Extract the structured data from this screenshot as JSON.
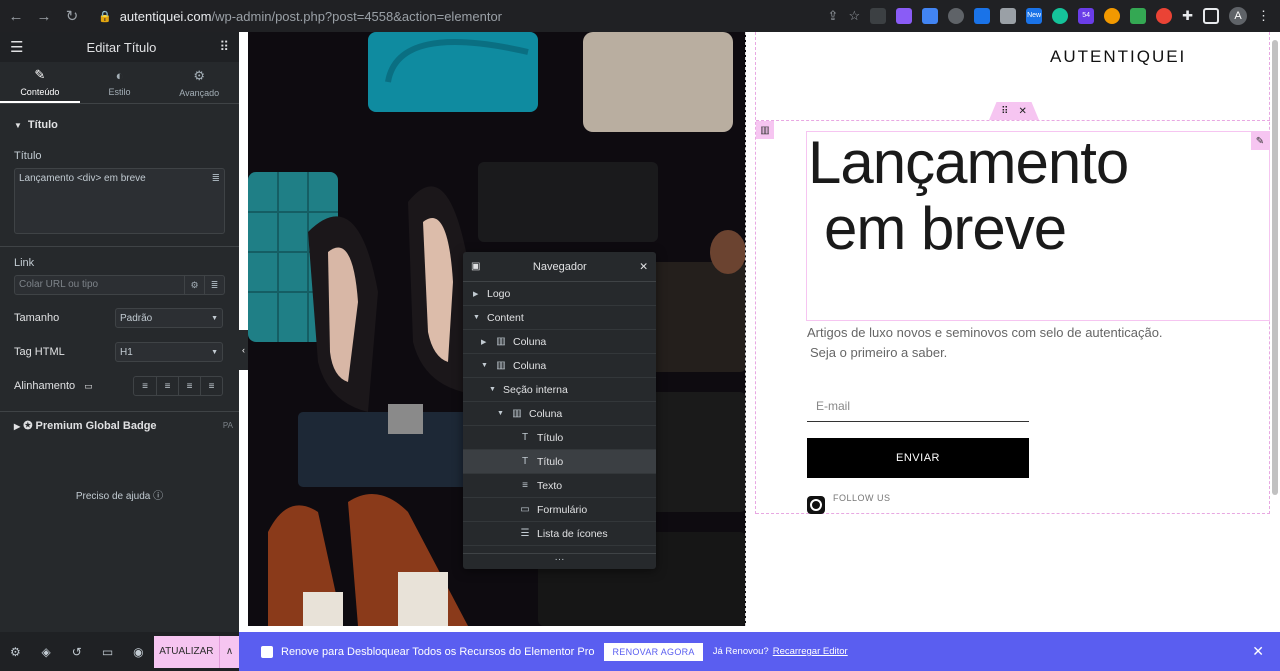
{
  "browser": {
    "host": "autentiquei.com",
    "path": "/wp-admin/post.php?post=4558&action=elementor",
    "avatar_letter": "A",
    "new_badge": "New",
    "badge_54": "54"
  },
  "panel": {
    "title": "Editar Título",
    "tabs": [
      {
        "label": "Conteúdo",
        "icon": "pencil-icon"
      },
      {
        "label": "Estilo",
        "icon": "contrast-icon"
      },
      {
        "label": "Avançado",
        "icon": "gear-icon"
      }
    ],
    "section_title": "Título",
    "title_label": "Título",
    "title_value": "Lançamento <div> em breve",
    "link_label": "Link",
    "link_placeholder": "Colar URL ou tipo",
    "size_label": "Tamanho",
    "size_value": "Padrão",
    "tag_label": "Tag HTML",
    "tag_value": "H1",
    "align_label": "Alinhamento",
    "premium_label": "Premium Global Badge",
    "premium_badge": "PA",
    "help": "Preciso de ajuda"
  },
  "footer": {
    "update_label": "ATUALIZAR"
  },
  "navigator": {
    "title": "Navegador",
    "items": [
      {
        "label": "Logo",
        "indent": 0,
        "arrow": "▶",
        "icon": ""
      },
      {
        "label": "Content",
        "indent": 0,
        "arrow": "▼",
        "icon": ""
      },
      {
        "label": "Coluna",
        "indent": 1,
        "arrow": "▶",
        "icon": "column-icon"
      },
      {
        "label": "Coluna",
        "indent": 1,
        "arrow": "▼",
        "icon": "column-icon"
      },
      {
        "label": "Seção interna",
        "indent": 2,
        "arrow": "▼",
        "icon": ""
      },
      {
        "label": "Coluna",
        "indent": 3,
        "arrow": "▼",
        "icon": "column-icon"
      },
      {
        "label": "Título",
        "indent": 4,
        "arrow": "",
        "icon": "heading-icon"
      },
      {
        "label": "Título",
        "indent": 4,
        "arrow": "",
        "icon": "heading-icon",
        "selected": true
      },
      {
        "label": "Texto",
        "indent": 4,
        "arrow": "",
        "icon": "text-icon"
      },
      {
        "label": "Formulário",
        "indent": 4,
        "arrow": "",
        "icon": "form-icon"
      },
      {
        "label": "Lista de ícones",
        "indent": 4,
        "arrow": "",
        "icon": "list-icon"
      }
    ]
  },
  "page": {
    "logo": "AUTENTIQUEI",
    "heading_line1": "Lançamento",
    "heading_line2": "em breve",
    "sub_line1": "Artigos de luxo novos e seminovos com selo de autenticação.",
    "sub_line2": "Seja o primeiro a saber.",
    "email_placeholder": "E-mail",
    "send_label": "ENVIAR",
    "follow": "FOLLOW US"
  },
  "promo": {
    "message": "Renove para Desbloquear Todos os Recursos do Elementor Pro",
    "renew_label": "RENOVAR AGORA",
    "already": "Já Renovou?",
    "reload": "Recarregar Editor"
  },
  "colors": {
    "accent_pink": "#f6c5f1",
    "promo_blue": "#5a5ef0",
    "panel_dark": "#26292c"
  }
}
